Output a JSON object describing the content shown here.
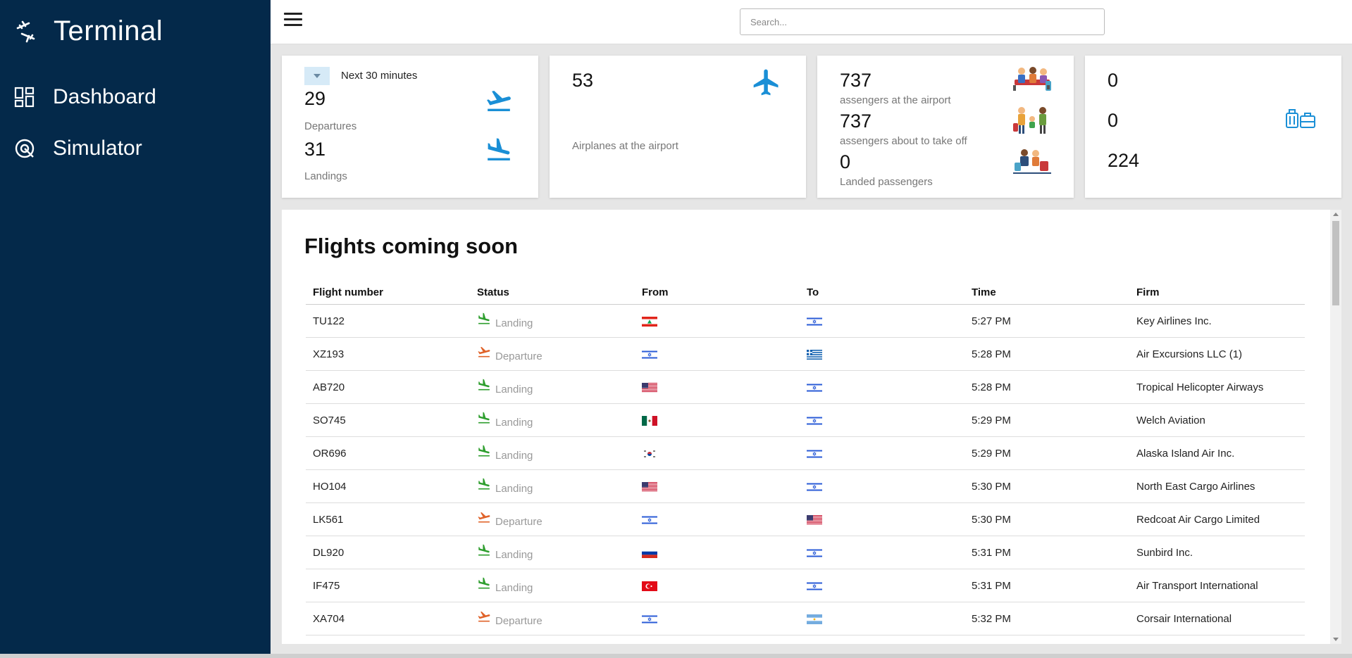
{
  "sidebar": {
    "title": "Terminal",
    "items": [
      {
        "label": "Dashboard",
        "icon": "dashboard-icon"
      },
      {
        "label": "Simulator",
        "icon": "simulator-icon"
      }
    ]
  },
  "topbar": {
    "search_placeholder": "Search...",
    "menu_icon": "hamburger-icon"
  },
  "stats": {
    "window": {
      "range_label": "Next 30 minutes",
      "departures_value": "29",
      "departures_label": "Departures",
      "landings_value": "31",
      "landings_label": "Landings"
    },
    "airplanes": {
      "value": "53",
      "label": "Airplanes at the airport"
    },
    "passengers": {
      "at_airport_value": "737",
      "at_airport_label": "assengers at the airport",
      "takeoff_value": "737",
      "takeoff_label": "assengers about to take off",
      "landed_value": "0",
      "landed_label": "Landed passengers"
    },
    "luggage": {
      "value1": "0",
      "value2": "0",
      "value3": "224"
    }
  },
  "flights": {
    "title": "Flights coming soon",
    "columns": [
      "Flight number",
      "Status",
      "From",
      "To",
      "Time",
      "Firm"
    ],
    "rows": [
      {
        "number": "TU122",
        "status": "Landing",
        "from": "LB",
        "to": "IL",
        "time": "5:27 PM",
        "firm": "Key Airlines Inc."
      },
      {
        "number": "XZ193",
        "status": "Departure",
        "from": "IL",
        "to": "GR",
        "time": "5:28 PM",
        "firm": "Air Excursions LLC (1)"
      },
      {
        "number": "AB720",
        "status": "Landing",
        "from": "US",
        "to": "IL",
        "time": "5:28 PM",
        "firm": "Tropical Helicopter Airways"
      },
      {
        "number": "SO745",
        "status": "Landing",
        "from": "MX",
        "to": "IL",
        "time": "5:29 PM",
        "firm": "Welch Aviation"
      },
      {
        "number": "OR696",
        "status": "Landing",
        "from": "KR",
        "to": "IL",
        "time": "5:29 PM",
        "firm": "Alaska Island Air Inc."
      },
      {
        "number": "HO104",
        "status": "Landing",
        "from": "US",
        "to": "IL",
        "time": "5:30 PM",
        "firm": "North East Cargo Airlines"
      },
      {
        "number": "LK561",
        "status": "Departure",
        "from": "IL",
        "to": "US",
        "time": "5:30 PM",
        "firm": "Redcoat Air Cargo Limited"
      },
      {
        "number": "DL920",
        "status": "Landing",
        "from": "RU",
        "to": "IL",
        "time": "5:31 PM",
        "firm": "Sunbird Inc."
      },
      {
        "number": "IF475",
        "status": "Landing",
        "from": "TR",
        "to": "IL",
        "time": "5:31 PM",
        "firm": "Air Transport International"
      },
      {
        "number": "XA704",
        "status": "Departure",
        "from": "IL",
        "to": "AR",
        "time": "5:32 PM",
        "firm": "Corsair International"
      }
    ]
  },
  "colors": {
    "sidebar": "#04294a",
    "accent": "#1a8fd6",
    "landing": "#2e9e2e",
    "departure": "#e0632a"
  }
}
